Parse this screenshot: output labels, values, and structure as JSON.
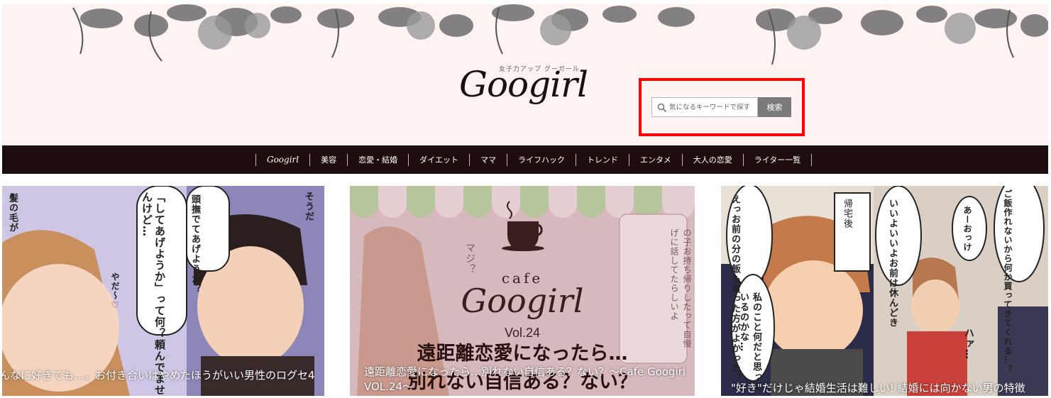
{
  "header": {
    "logo_tagline": "女子力アップ グーガール",
    "logo_text": "Googirl"
  },
  "search": {
    "placeholder": "気になるキーワードで探す",
    "button_label": "検索"
  },
  "nav": {
    "items": [
      "Googirl",
      "美容",
      "恋愛・結婚",
      "ダイエット",
      "ママ",
      "ライフハック",
      "トレンド",
      "エンタメ",
      "大人の恋愛",
      "ライター一覧"
    ]
  },
  "cards": [
    {
      "caption": "んなに好きでも…。お付き合いはやめたほうがいい男性のログセ4",
      "bubbles": [
        "「してあげようか」って何？頼んでませんけど…",
        "頭撫でてあげようか？",
        "そうだ",
        "やだ～♡",
        "髪の毛が"
      ]
    },
    {
      "cafe_word": "cafe",
      "cafe_logo": "Googirl",
      "cafe_vol": "Vol.24",
      "headline_line1": "遠距離恋愛になったら…",
      "headline_line2": "別れない自信ある？ない？",
      "caption": "遠距離恋愛になったら…別れない自信ある？ない？～Cafe Googirl VOL.24～",
      "bubbles": [
        "あんたの彼氏飲み会のあと女の子お持ち帰りしたって自慢げに話してたらしいよ",
        "マジ？"
      ]
    },
    {
      "caption": "\"好き\"だけじゃ結婚生活は難しい! 結婚には向かない男の特徴",
      "bubbles": [
        "えっお前の分の飯も買った方がよかった？",
        "帰宅後",
        "いいよいいよお前は休んどき",
        "あーおっけ",
        "ご飯作れないから何か買ってきてくれる…？",
        "私のこと何だと思っているのかな…",
        "ハァ…"
      ]
    }
  ],
  "colors": {
    "header_bg": "#fdf3f1",
    "nav_bg": "#1e0d0f",
    "search_button_bg": "#7a7a7a",
    "highlight": "#ff0000"
  }
}
